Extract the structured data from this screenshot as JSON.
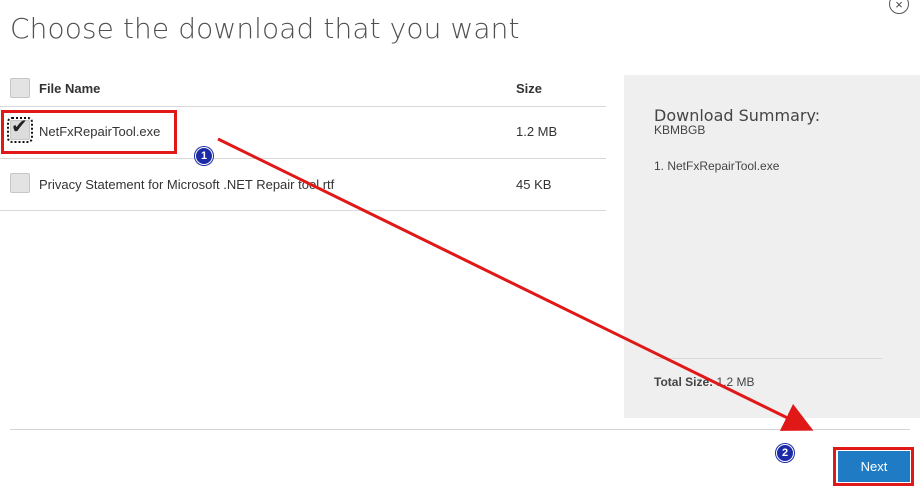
{
  "dialog": {
    "title": "Choose the download that you want",
    "close_symbol": "×"
  },
  "table": {
    "headers": {
      "name": "File Name",
      "size": "Size"
    },
    "rows": [
      {
        "name": "NetFxRepairTool.exe",
        "size": "1.2 MB",
        "checked": true
      },
      {
        "name": "Privacy Statement for Microsoft .NET Repair tool.rtf",
        "size": "45 KB",
        "checked": false
      }
    ]
  },
  "summary": {
    "title": "Download Summary:",
    "kb": "KBMBGB",
    "items": [
      "1. NetFxRepairTool.exe"
    ],
    "total_label": "Total Size:",
    "total_value": "1.2 MB"
  },
  "footer": {
    "next_label": "Next"
  },
  "annotations": {
    "step1": "1",
    "step2": "2",
    "highlight_color": "#e01818",
    "badge_color": "#1c2aa8"
  },
  "colors": {
    "accent": "#1f7cc4",
    "summary_bg": "#efefef"
  },
  "icons": {
    "check": "checkmark-icon",
    "close": "close-icon"
  }
}
